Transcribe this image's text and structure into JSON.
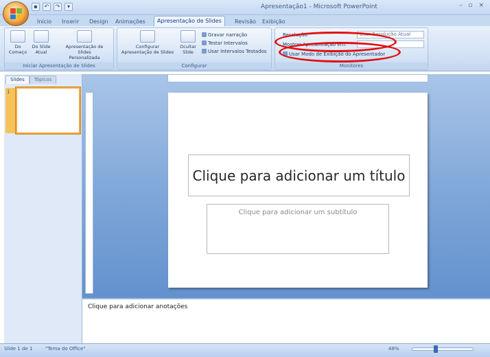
{
  "app": {
    "title": "Apresentação1 - Microsoft PowerPoint",
    "window_controls": "– ▫ ×"
  },
  "qat": [
    "save-icon",
    "undo-icon",
    "redo-icon",
    "customize-icon"
  ],
  "tabs": [
    {
      "label": "Início",
      "active": false
    },
    {
      "label": "Inserir",
      "active": false
    },
    {
      "label": "Design",
      "active": false
    },
    {
      "label": "Animações",
      "active": false
    },
    {
      "label": "Apresentação de Slides",
      "active": true
    },
    {
      "label": "Revisão",
      "active": false
    },
    {
      "label": "Exibição",
      "active": false
    }
  ],
  "ribbon": {
    "group_start": {
      "label": "Iniciar Apresentação de Slides",
      "buttons": [
        "Do Começo",
        "Do Slide Atual",
        "Apresentação de Slides Personalizada"
      ]
    },
    "group_config": {
      "label": "Configurar",
      "buttons": [
        "Configurar Apresentação de Slides",
        "Ocultar Slide"
      ],
      "items": [
        "Gravar narração",
        "Testar Intervalos",
        "Usar Intervalos Testados"
      ]
    },
    "group_monitors": {
      "label": "Monitores",
      "resolution_label": "Resolução:",
      "resolution_value": "Usar Resolução Atual",
      "show_on_label": "Mostrar Apresentação em:",
      "presenter_view": "Usar Modo de Exibição do Apresentador"
    }
  },
  "left_pane": {
    "tab_slides": "Slides",
    "tab_outline": "Tópicos",
    "slide_number": "1"
  },
  "slide": {
    "title_placeholder": "Clique para adicionar um título",
    "subtitle_placeholder": "Clique para adicionar um subtítulo"
  },
  "notes": {
    "placeholder": "Clique para adicionar anotações"
  },
  "status": {
    "slide_count": "Slide 1 de 1",
    "theme": "\"Tema do Office\"",
    "zoom": "48%"
  },
  "colors": {
    "highlight_oval": "#e01010",
    "ribbon_blue": "#d0e0f4",
    "editor_blue": "#7ea6d8"
  }
}
